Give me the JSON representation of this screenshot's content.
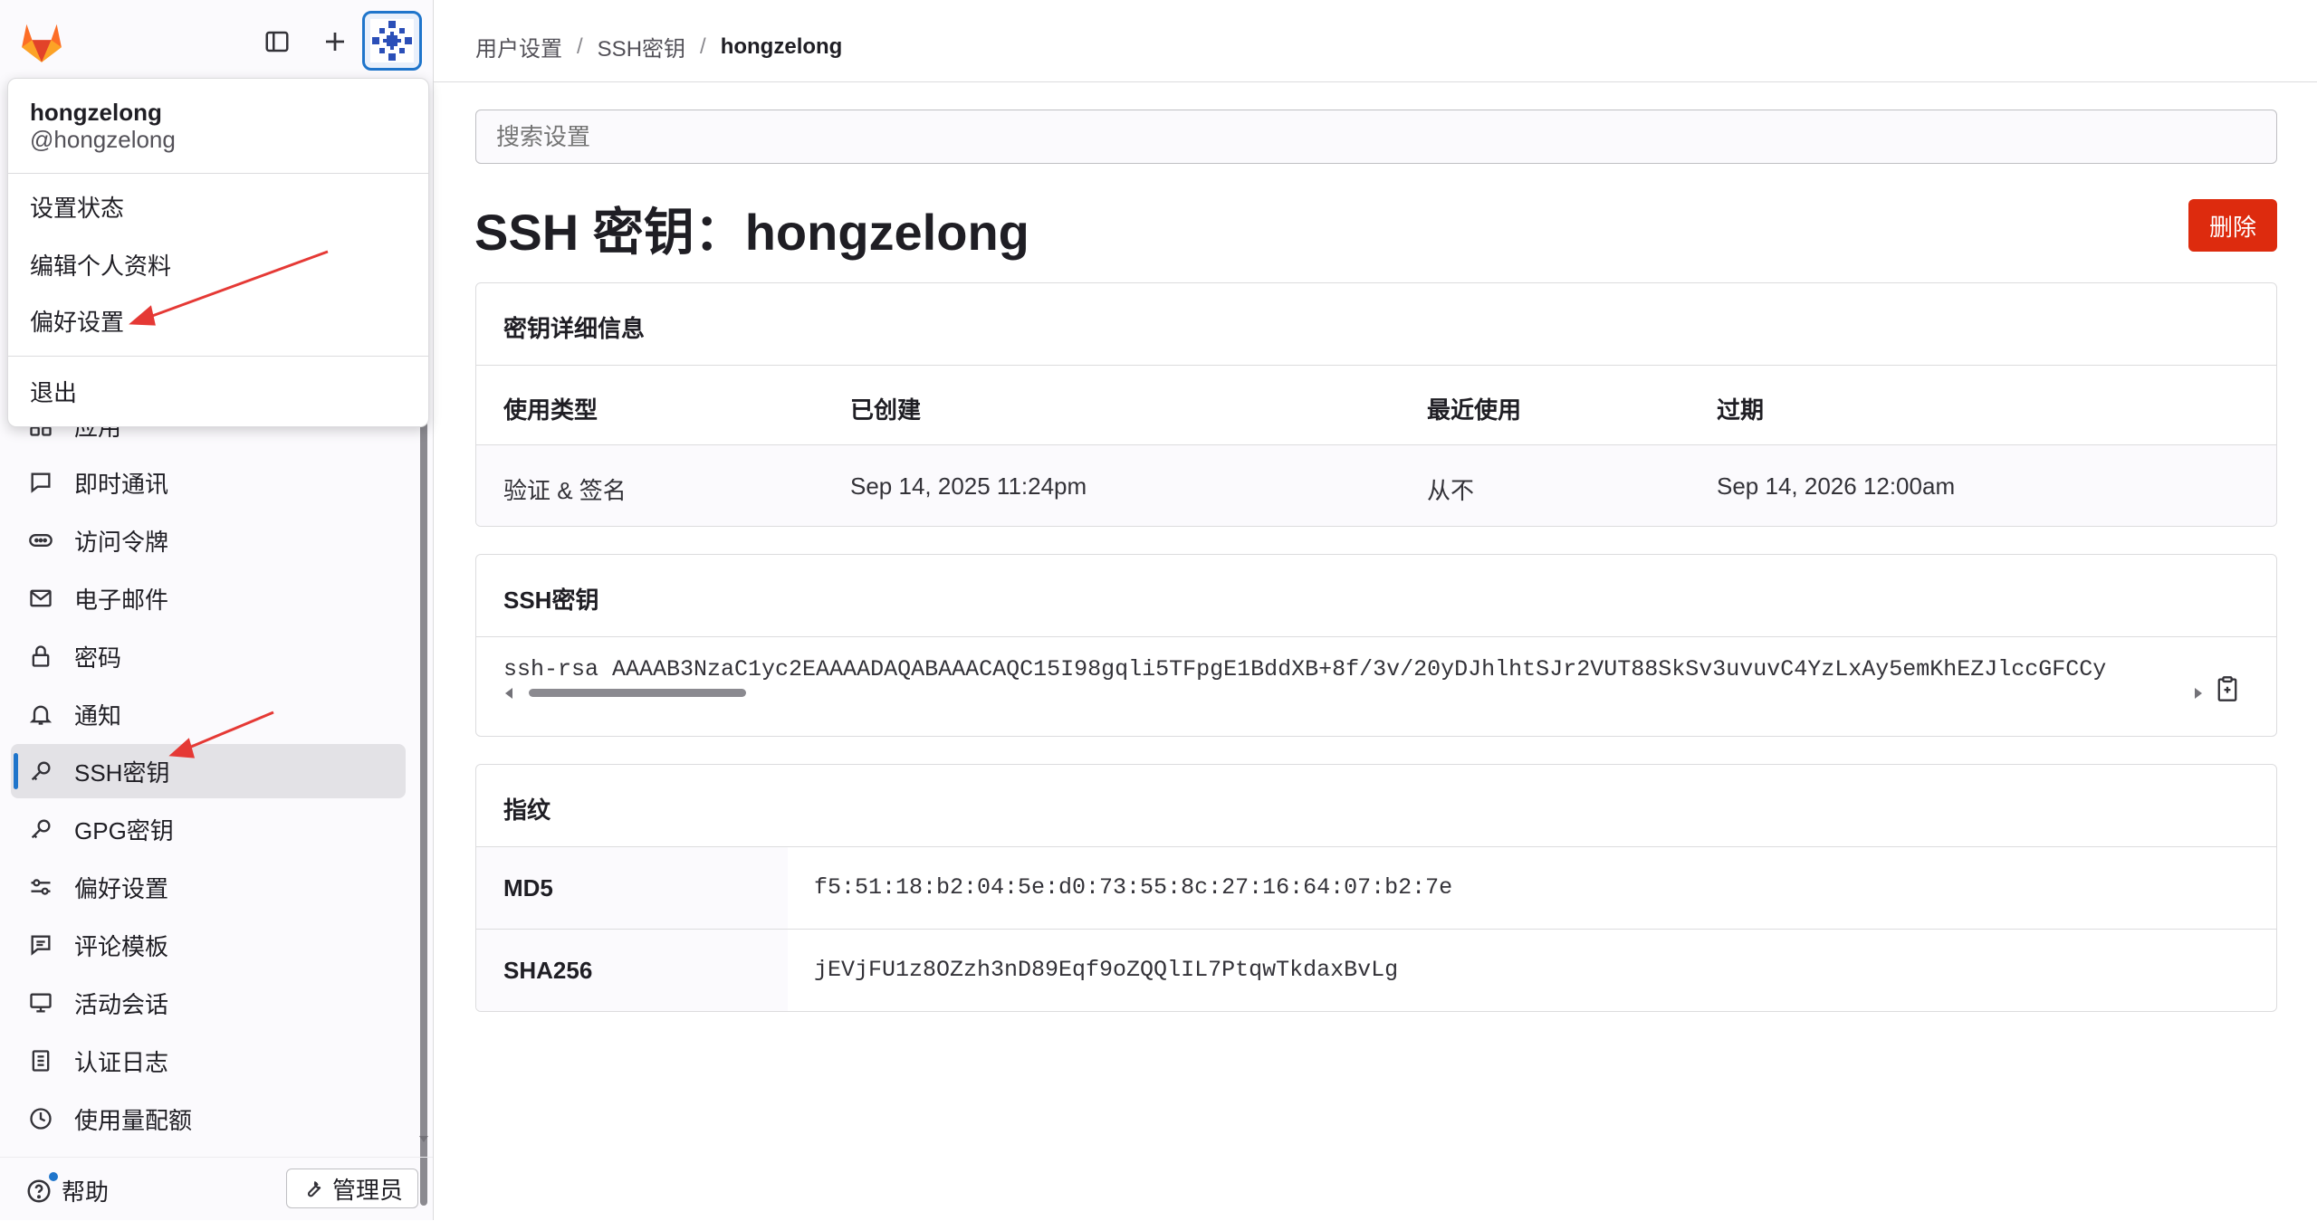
{
  "sidebar": {
    "nav_items": [
      {
        "label": "应用",
        "icon": "applications-icon"
      },
      {
        "label": "即时通讯",
        "icon": "comment-icon"
      },
      {
        "label": "访问令牌",
        "icon": "token-icon"
      },
      {
        "label": "电子邮件",
        "icon": "mail-icon"
      },
      {
        "label": "密码",
        "icon": "lock-icon"
      },
      {
        "label": "通知",
        "icon": "bell-icon"
      },
      {
        "label": "SSH密钥",
        "icon": "key-icon",
        "active": true
      },
      {
        "label": "GPG密钥",
        "icon": "key-icon"
      },
      {
        "label": "偏好设置",
        "icon": "preferences-icon"
      },
      {
        "label": "评论模板",
        "icon": "comment-template-icon"
      },
      {
        "label": "活动会话",
        "icon": "monitor-icon"
      },
      {
        "label": "认证日志",
        "icon": "log-icon"
      },
      {
        "label": "使用量配额",
        "icon": "quota-icon"
      }
    ],
    "help_label": "帮助",
    "admin_label": "管理员"
  },
  "user_menu": {
    "name": "hongzelong",
    "handle": "@hongzelong",
    "items": [
      "设置状态",
      "编辑个人资料",
      "偏好设置"
    ],
    "signout": "退出"
  },
  "breadcrumb": [
    "用户设置",
    "SSH密钥",
    "hongzelong"
  ],
  "search_placeholder": "搜索设置",
  "page": {
    "title": "SSH 密钥：hongzelong",
    "delete_label": "删除"
  },
  "details": {
    "header": "密钥详细信息",
    "columns": [
      "使用类型",
      "已创建",
      "最近使用",
      "过期"
    ],
    "values": [
      "验证 & 签名",
      "Sep 14, 2025 11:24pm",
      "从不",
      "Sep 14, 2026 12:00am"
    ]
  },
  "ssh_key": {
    "header": "SSH密钥",
    "value": "ssh-rsa AAAAB3NzaC1yc2EAAAADAQABAAACAQC15I98gqli5TFpgE1BddXB+8f/3v/20yDJhlhtSJr2VUT88SkSv3uvuvC4YzLxAy5emKhEZJlccGFCCy"
  },
  "fingerprints": {
    "header": "指纹",
    "rows": [
      {
        "label": "MD5",
        "value": "f5:51:18:b2:04:5e:d0:73:55:8c:27:16:64:07:b2:7e"
      },
      {
        "label": "SHA256",
        "value": "jEVjFU1z8OZzh3nD89Eqf9oZQQlIL7PtqwTkdaxBvLg"
      }
    ]
  },
  "colors": {
    "accent": "#1f75cb",
    "danger": "#dd2b0e",
    "annotation_arrow": "#e53935"
  }
}
